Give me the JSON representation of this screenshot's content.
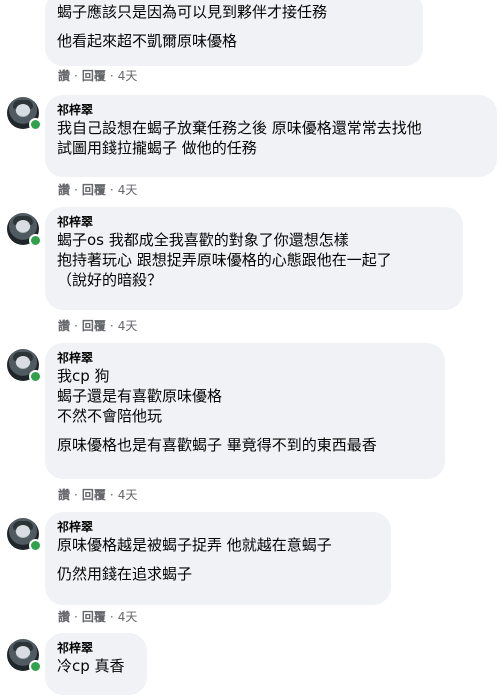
{
  "actions": {
    "like": "讚",
    "reply": "回覆",
    "sep": "·"
  },
  "comments": [
    {
      "author": "",
      "lines": [
        "蝎子應該只是因為可以見到夥伴才接任務"
      ],
      "lines2": [
        "他看起來超不凱爾原味優格"
      ],
      "time": "4天"
    },
    {
      "author": "祁梓翠",
      "lines": [
        "我自己設想在蝎子放棄任務之後 原味優格還常常去找他",
        "試圖用錢拉攏蝎子 做他的任務"
      ],
      "time": "4天"
    },
    {
      "author": "祁梓翠",
      "lines": [
        "蝎子os 我都成全我喜歡的對象了你還想怎樣",
        "抱持著玩心 跟想捉弄原味優格的心態跟他在一起了",
        "（說好的暗殺？"
      ],
      "time": "4天"
    },
    {
      "author": "祁梓翠",
      "lines": [
        "我cp 狗",
        "蝎子還是有喜歡原味優格",
        "不然不會陪他玩"
      ],
      "lines2": [
        "原味優格也是有喜歡蝎子 畢竟得不到的東西最香"
      ],
      "time": "4天"
    },
    {
      "author": "祁梓翠",
      "lines": [
        "原味優格越是被蝎子捉弄 他就越在意蝎子"
      ],
      "lines2": [
        "仍然用錢在追求蝎子"
      ],
      "time": "4天"
    },
    {
      "author": "祁梓翠",
      "lines": [
        "冷cp 真香"
      ]
    }
  ]
}
